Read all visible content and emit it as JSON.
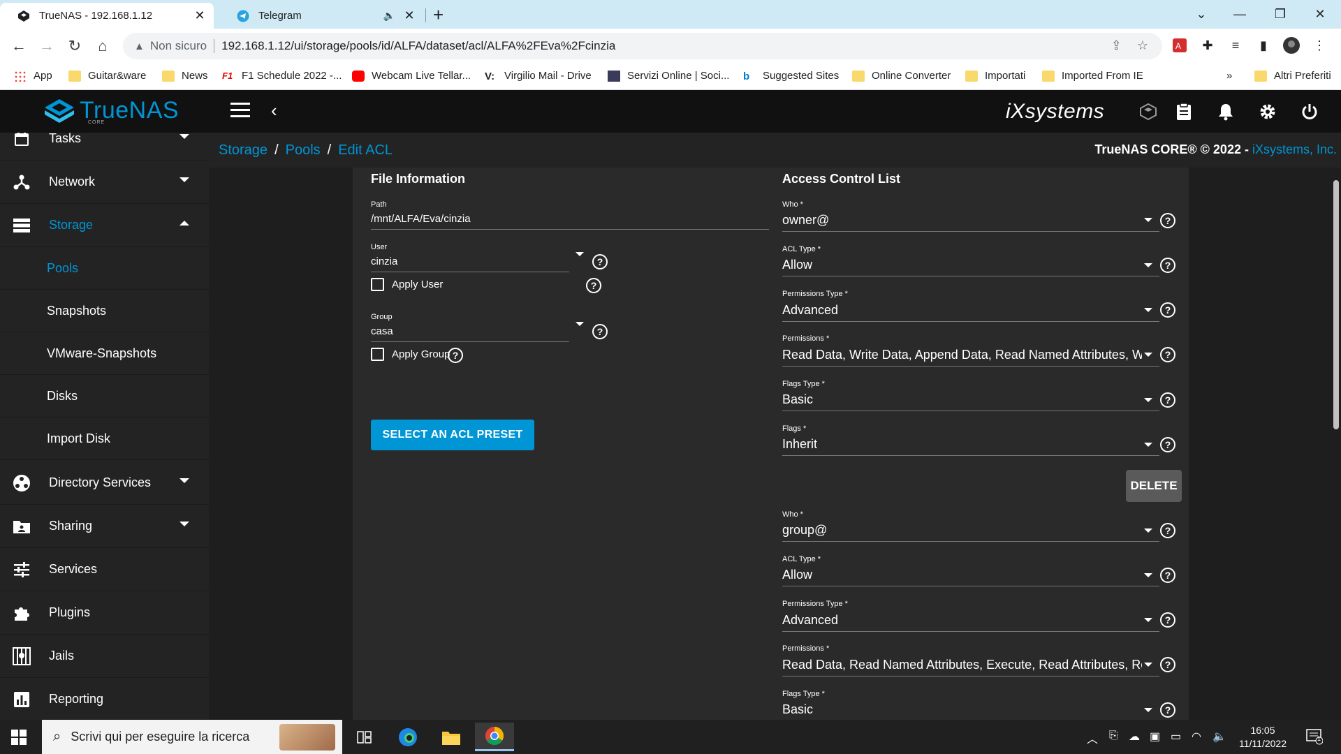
{
  "browser": {
    "tabs": [
      {
        "title": "TrueNAS - 192.168.1.12",
        "active": true
      },
      {
        "title": "Telegram",
        "active": false
      }
    ],
    "address": {
      "security": "Non sicuro",
      "url": "192.168.1.12/ui/storage/pools/id/ALFA/dataset/acl/ALFA%2FEva%2Fcinzia"
    },
    "bookmarks": [
      {
        "label": "App",
        "icon": "apps-grid-icon"
      },
      {
        "label": "Guitar&ware",
        "icon": "folder-icon"
      },
      {
        "label": "News",
        "icon": "folder-icon"
      },
      {
        "label": "F1 Schedule 2022 -...",
        "icon": "f1-icon"
      },
      {
        "label": "Webcam Live Tellar...",
        "icon": "youtube-icon"
      },
      {
        "label": "Virgilio Mail - Drive",
        "icon": "virgilio-icon"
      },
      {
        "label": "Servizi Online | Soci...",
        "icon": "site-icon"
      },
      {
        "label": "Suggested Sites",
        "icon": "bing-icon"
      },
      {
        "label": "Online Converter",
        "icon": "folder-icon"
      },
      {
        "label": "Importati",
        "icon": "folder-icon"
      },
      {
        "label": "Imported From IE",
        "icon": "folder-icon"
      }
    ],
    "bookmarks_more": "»",
    "other_bookmarks": "Altri Preferiti"
  },
  "topbar": {
    "logo_text": "TrueNAS",
    "logo_sub": "CORE",
    "vendor_logo": "iXsystems"
  },
  "sidebar": {
    "items": [
      {
        "label": "Tasks",
        "icon": "calendar-icon",
        "caret": "down"
      },
      {
        "label": "Network",
        "icon": "network-icon",
        "caret": "down"
      },
      {
        "label": "Storage",
        "icon": "storage-icon",
        "caret": "up",
        "active": true
      }
    ],
    "subitems": [
      {
        "label": "Pools",
        "active": true
      },
      {
        "label": "Snapshots"
      },
      {
        "label": "VMware-Snapshots"
      },
      {
        "label": "Disks"
      },
      {
        "label": "Import Disk"
      }
    ],
    "items2": [
      {
        "label": "Directory Services",
        "icon": "directory-icon",
        "caret": "down"
      },
      {
        "label": "Sharing",
        "icon": "sharing-icon",
        "caret": "down"
      },
      {
        "label": "Services",
        "icon": "services-icon"
      },
      {
        "label": "Plugins",
        "icon": "puzzle-icon"
      },
      {
        "label": "Jails",
        "icon": "jail-icon"
      },
      {
        "label": "Reporting",
        "icon": "chart-icon"
      }
    ]
  },
  "breadcrumb": {
    "items": [
      "Storage",
      "Pools",
      "Edit ACL"
    ],
    "separator": "/"
  },
  "copyright": {
    "text": "TrueNAS CORE® © 2022 - ",
    "link": "iXsystems, Inc."
  },
  "file_info": {
    "title": "File Information",
    "path_label": "Path",
    "path_value": "/mnt/ALFA/Eva/cinzia",
    "user_label": "User",
    "user_value": "cinzia",
    "apply_user": "Apply User",
    "group_label": "Group",
    "group_value": "casa",
    "apply_group": "Apply Group",
    "preset_button": "SELECT AN ACL PRESET"
  },
  "acl": {
    "title": "Access Control List",
    "entry1": {
      "who_label": "Who *",
      "who": "owner@",
      "type_label": "ACL Type *",
      "type": "Allow",
      "ptype_label": "Permissions Type *",
      "ptype": "Advanced",
      "perm_label": "Permissions *",
      "perm": "Read Data, Write Data, Append Data, Read Named Attributes, Wri...",
      "ftype_label": "Flags Type *",
      "ftype": "Basic",
      "flags_label": "Flags *",
      "flags": "Inherit"
    },
    "delete_button": "DELETE",
    "entry2": {
      "who_label": "Who *",
      "who": "group@",
      "type_label": "ACL Type *",
      "type": "Allow",
      "ptype_label": "Permissions Type *",
      "ptype": "Advanced",
      "perm_label": "Permissions *",
      "perm": "Read Data, Read Named Attributes, Execute, Read Attributes, Rea...",
      "ftype_label": "Flags Type *",
      "ftype": "Basic"
    }
  },
  "taskbar": {
    "search_placeholder": "Scrivi qui per eseguire la ricerca",
    "time": "16:05",
    "date": "11/11/2022",
    "notifications": "1"
  },
  "colors": {
    "accent": "#0095d5",
    "sidebar_bg": "#232323",
    "card_bg": "#2a2a2a",
    "topbar_bg": "#111111"
  }
}
